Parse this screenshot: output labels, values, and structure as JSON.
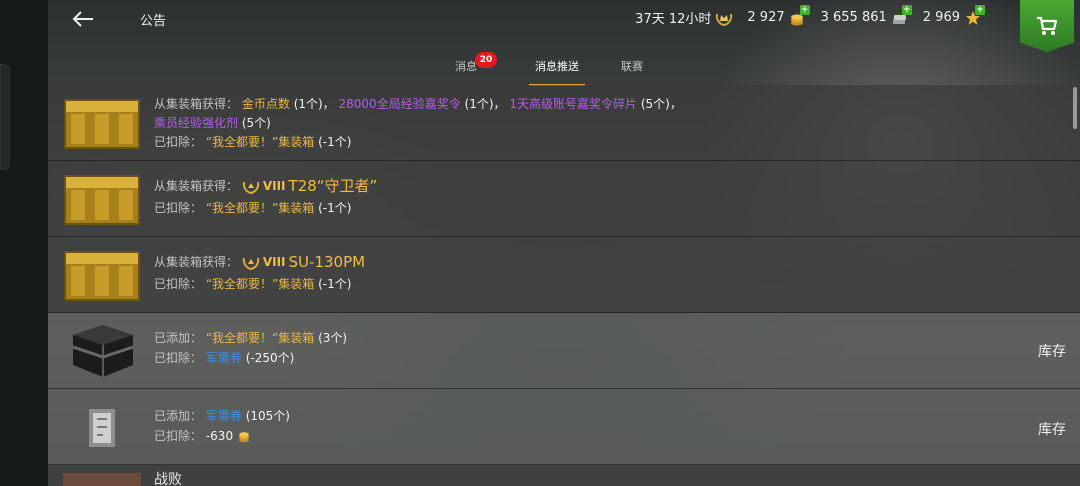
{
  "header": {
    "title": "公告",
    "premium_time": "37天 12小时",
    "gold": "2 927",
    "credits": "3 655 861",
    "free_xp": "2 969"
  },
  "tabs": [
    {
      "label": "消息",
      "badge": "20"
    },
    {
      "label": "消息推送"
    },
    {
      "label": "联赛"
    }
  ],
  "messages": {
    "row1": {
      "obtained_label": "从集装箱获得：",
      "item1": "金币点数",
      "item1_count": "(1个)，",
      "item2": "28000全局经验嘉奖令",
      "item2_count": "(1个)，",
      "item3": "1天高级账号嘉奖令碎片",
      "item3_count": "(5个)，",
      "item4": "乘员经验强化剂",
      "item4_count": "(5个)",
      "deducted_label": "已扣除：",
      "deducted_item": "“我全都要！”集装箱",
      "deducted_count": "(-1个)"
    },
    "row2": {
      "obtained_label": "从集装箱获得：",
      "tier": "VIII",
      "tank": "T28“守卫者”",
      "deducted_label": "已扣除：",
      "deducted_item": "“我全都要！”集装箱",
      "deducted_count": "(-1个)"
    },
    "row3": {
      "obtained_label": "从集装箱获得：",
      "tier": "VIII",
      "tank": "SU-130PM",
      "deducted_label": "已扣除：",
      "deducted_item": "“我全都要！”集装箱",
      "deducted_count": "(-1个)"
    },
    "row4": {
      "added_label": "已添加：",
      "added_item": "“我全都要！”集装箱",
      "added_count": "(3个)",
      "deducted_label": "已扣除：",
      "deducted_item": "军需券",
      "deducted_count": "(-250个)",
      "action": "库存"
    },
    "row5": {
      "added_label": "已添加：",
      "added_item": "军需券",
      "added_count": "(105个)",
      "deducted_label": "已扣除：",
      "deducted_value": "-630",
      "action": "库存"
    },
    "row6": {
      "title": "战败"
    }
  },
  "colors": {
    "gold_text": "#e9b648",
    "purple_text": "#b65be6",
    "blue_text": "#3d8fe6",
    "tab_underline": "#f0a23a",
    "badge": "#e01d1d",
    "shop_green": "#3e9a2c"
  },
  "icons": [
    "back-arrow-icon",
    "premium-crown-icon",
    "gold-coins-icon",
    "credits-icon",
    "free-xp-icon",
    "shopping-cart-icon",
    "tier-laurel-icon",
    "gold-coin-icon"
  ]
}
